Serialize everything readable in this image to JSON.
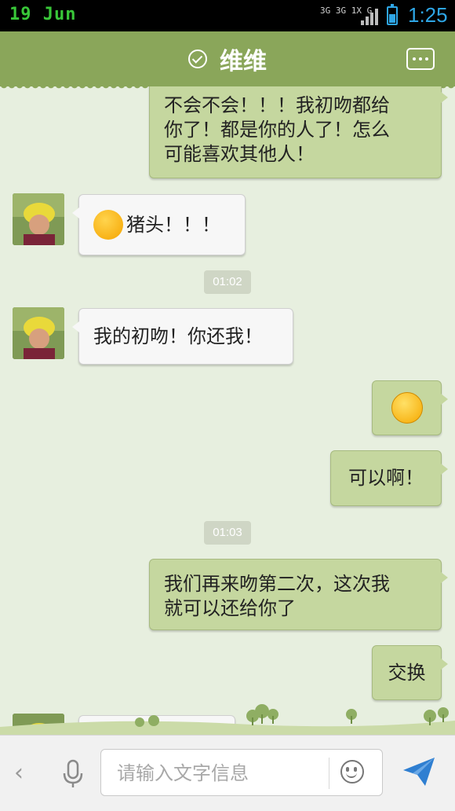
{
  "status_bar": {
    "date": "19 Jun",
    "network": "3G 3G 1X G",
    "time": "1:25",
    "battery_level": 0.55
  },
  "header": {
    "title": "维维",
    "verified_icon": "check-circle-icon",
    "menu_icon": "more-icon"
  },
  "messages": [
    {
      "side": "out",
      "text": "不会不会！！！我初吻都给\n你了！都是你的人了！怎么\n可能喜欢其他人！"
    },
    {
      "side": "in",
      "emoji": "laugh-emoji",
      "text": "猪头！！！"
    },
    {
      "type": "timestamp",
      "text": "01:02"
    },
    {
      "side": "in",
      "text": "我的初吻！你还我！"
    },
    {
      "side": "out",
      "emoji": "smile-emoji",
      "text": ""
    },
    {
      "side": "out",
      "text": "可以啊！"
    },
    {
      "type": "timestamp",
      "text": "01:03"
    },
    {
      "side": "out",
      "text": "我们再来吻第二次，这次我\n就可以还给你了"
    },
    {
      "side": "out",
      "text": "交换"
    }
  ],
  "input_bar": {
    "placeholder": "请输入文字信息",
    "back_icon": "chevron-left-icon",
    "voice_icon": "microphone-icon",
    "emoji_icon": "smiley-face-icon",
    "send_icon": "send-icon"
  },
  "colors": {
    "header": "#8aa65a",
    "outgoing_bubble": "#c5d79f",
    "incoming_bubble": "#f7f7f7",
    "background": "#e7efdf",
    "send": "#2f7fd1"
  }
}
